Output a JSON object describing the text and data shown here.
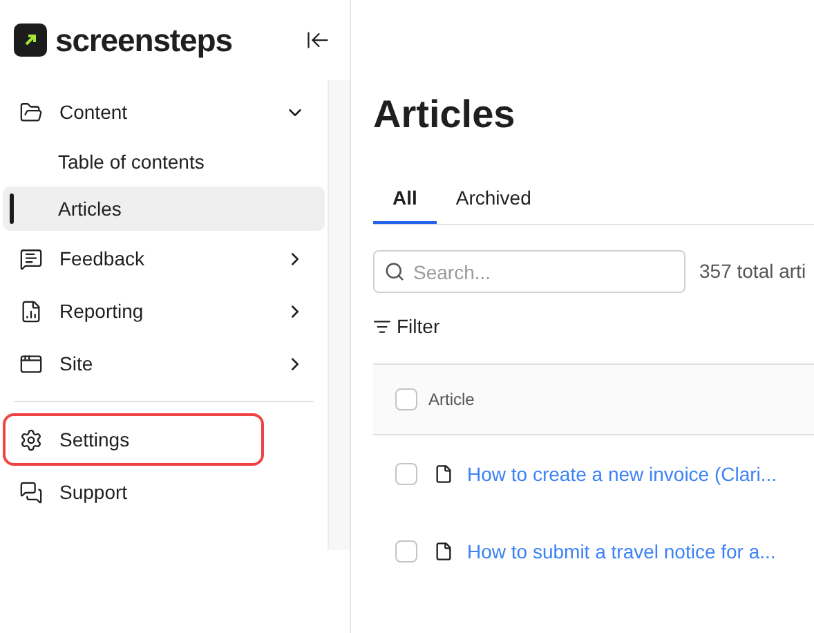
{
  "brand": {
    "name": "screensteps"
  },
  "sidebar": {
    "items": [
      {
        "kind": "group",
        "label": "Content",
        "expanded": true,
        "children": [
          {
            "label": "Table of contents",
            "selected": false
          },
          {
            "label": "Articles",
            "selected": true
          }
        ]
      },
      {
        "kind": "group",
        "label": "Feedback",
        "expanded": false
      },
      {
        "kind": "group",
        "label": "Reporting",
        "expanded": false
      },
      {
        "kind": "group",
        "label": "Site",
        "expanded": false
      },
      {
        "kind": "divider"
      },
      {
        "kind": "link",
        "label": "Settings",
        "highlighted": true
      },
      {
        "kind": "link",
        "label": "Support",
        "highlighted": false
      }
    ]
  },
  "page": {
    "title": "Articles",
    "tabs": [
      {
        "label": "All",
        "selected": true
      },
      {
        "label": "Archived",
        "selected": false
      }
    ],
    "search": {
      "placeholder": "Search..."
    },
    "count": "357 total arti",
    "filter": "Filter",
    "table": {
      "columns": [
        "Article"
      ],
      "all_checked": false,
      "rows": [
        {
          "title": "How to create a new invoice (Clari...",
          "checked": false
        },
        {
          "title": "How to submit a travel notice for a...",
          "checked": false
        }
      ]
    }
  }
}
